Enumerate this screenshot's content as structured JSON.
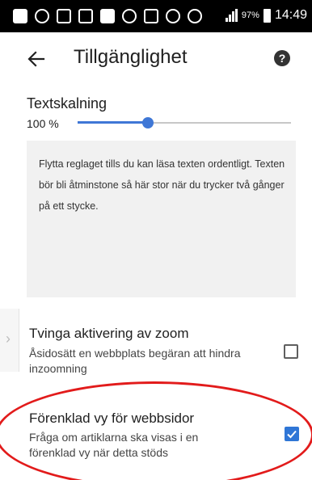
{
  "status_bar": {
    "icons": [
      "message-icon",
      "record-icon",
      "gallery-icon",
      "sync-icon",
      "email-icon",
      "bluetooth-icon",
      "checklist-icon",
      "bluetooth-icon",
      "alarm-icon",
      "wifi-icon",
      "signal-icon"
    ],
    "battery": "97%",
    "time": "14:49"
  },
  "app_bar": {
    "title": "Tillgänglighet",
    "back_icon": "arrow-left-icon",
    "help_icon": "help-icon",
    "help_glyph": "?"
  },
  "text_scaling": {
    "label": "Textskalning",
    "value": "100 %",
    "slider_fraction": 0.33,
    "preview_text": "Flytta reglaget tills du kan läsa texten ordentligt. Texten bör bli åtminstone så här stor när du trycker två gånger på ett stycke."
  },
  "settings": [
    {
      "title": "Tvinga aktivering av zoom",
      "description": "Åsidosätt en webbplats begäran att hindra inzoomning",
      "checked": false
    },
    {
      "title": "Förenklad vy för webbsidor",
      "description": "Fråga om artiklarna ska visas i en förenklad vy när detta stöds",
      "checked": true
    }
  ],
  "edge_tab": {
    "glyph": "›"
  },
  "colors": {
    "accent": "#3f77d6",
    "checkbox_checked": "#2f76d6",
    "highlight": "#e21b1b"
  }
}
